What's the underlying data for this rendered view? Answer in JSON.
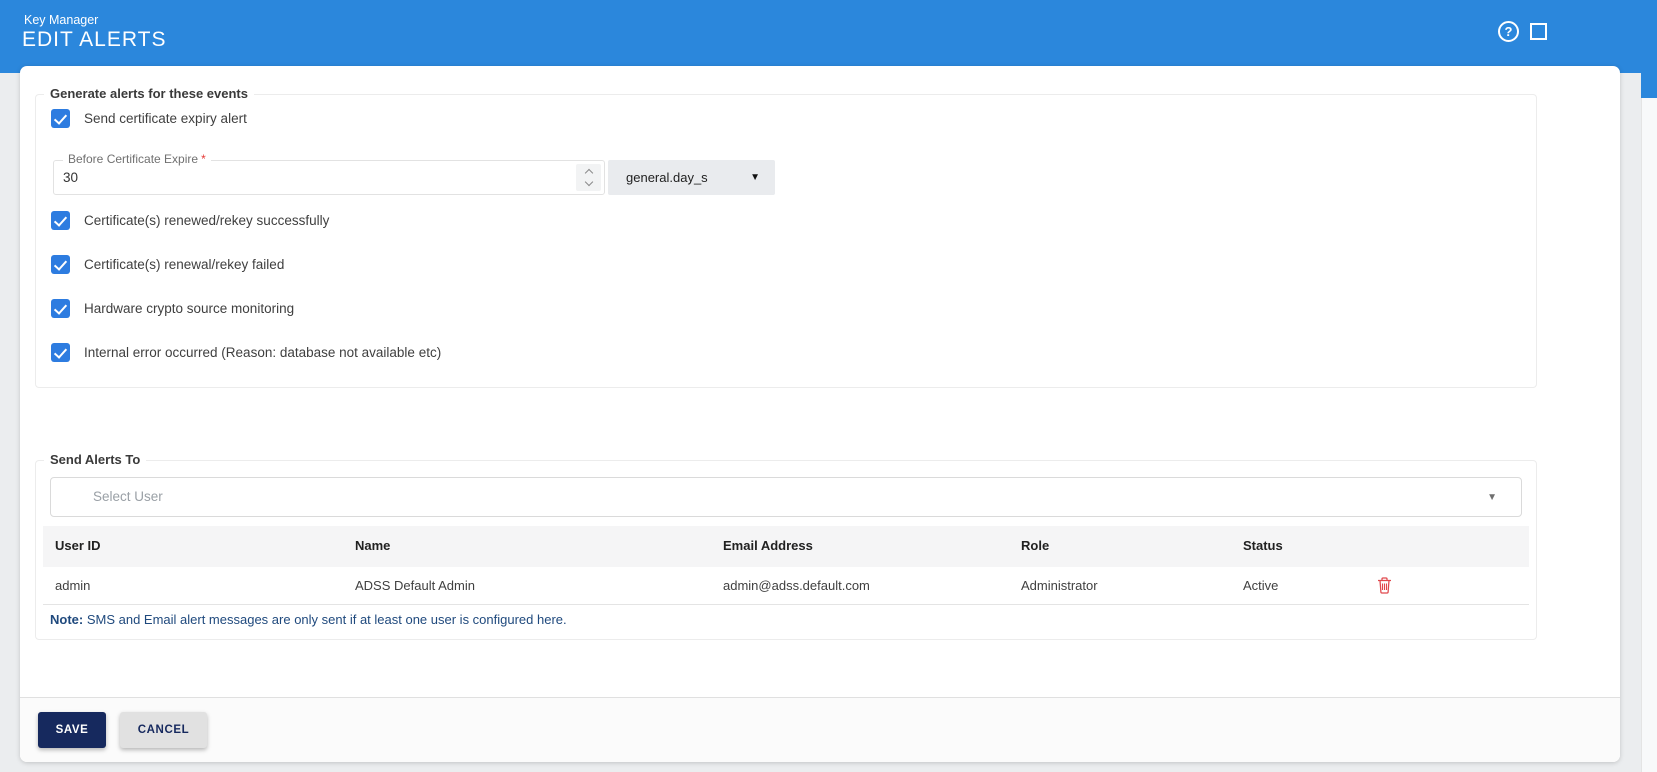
{
  "header": {
    "app": "Key Manager",
    "title": "EDIT ALERTS"
  },
  "events": {
    "legend": "Generate alerts for these events",
    "checkboxes": [
      {
        "label": "Send certificate expiry alert",
        "checked": true
      },
      {
        "label": "Certificate(s) renewed/rekey successfully",
        "checked": true
      },
      {
        "label": "Certificate(s) renewal/rekey failed",
        "checked": true
      },
      {
        "label": "Hardware crypto source monitoring",
        "checked": true
      },
      {
        "label": "Internal error occurred (Reason: database not available etc)",
        "checked": true
      }
    ],
    "expiry": {
      "label": "Before Certificate Expire",
      "required": "*",
      "value": "30",
      "unit": "general.day_s"
    }
  },
  "alerts": {
    "legend": "Send Alerts To",
    "select_placeholder": "Select User",
    "table": {
      "headers": [
        "User ID",
        "Name",
        "Email Address",
        "Role",
        "Status"
      ],
      "rows": [
        [
          "admin",
          "ADSS Default Admin",
          "admin@adss.default.com",
          "Administrator",
          "Active"
        ]
      ]
    },
    "note_prefix": "Note:",
    "note_text": " SMS and Email alert messages are only sent if at least one user is configured here."
  },
  "footer": {
    "save_label": "SAVE",
    "cancel_label": "CANCEL"
  },
  "colors": {
    "header_blue": "#2b87dc",
    "checkbox_blue": "#2d7ce0",
    "save_navy": "#16295e",
    "note_blue": "#1f497d",
    "delete_red": "#e0474c",
    "required_red": "#e53935"
  }
}
